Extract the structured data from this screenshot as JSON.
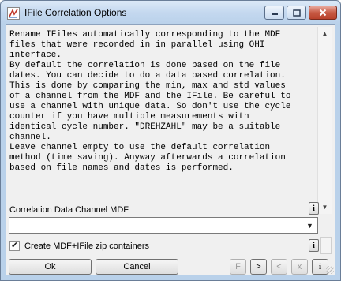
{
  "window": {
    "title": "IFile Correlation Options"
  },
  "description_lines": [
    "Rename IFiles automatically corresponding to the MDF",
    "files that were recorded in in parallel using OHI",
    "interface.",
    "By default the correlation is done based on the file",
    "dates. You can decide to do a data based correlation.",
    "This is done by comparing the min, max and std values",
    "of a channel from the MDF and the IFile. Be careful to",
    "use a channel with unique data. So don't use the cycle",
    "counter if you have multiple measurements with",
    "identical cycle number. \"DREHZAHL\" may be a suitable",
    "channel.",
    "Leave channel empty to use the default correlation",
    "method (time saving). Anyway afterwards a correlation",
    "based on file names and dates is performed."
  ],
  "channel": {
    "label": "Correlation Data Channel MDF",
    "value": "",
    "info_label": "i"
  },
  "zip": {
    "label": "Create MDF+IFile zip containers",
    "checked": true,
    "info_label": "i"
  },
  "buttons": {
    "ok": "Ok",
    "cancel": "Cancel",
    "f": "F",
    "next": ">",
    "prev": "<",
    "x": "x",
    "info": "i"
  },
  "colors": {
    "titlebar": "#c4d8ef",
    "client_bg": "#f0f0f0",
    "close_button": "#c75a44"
  }
}
